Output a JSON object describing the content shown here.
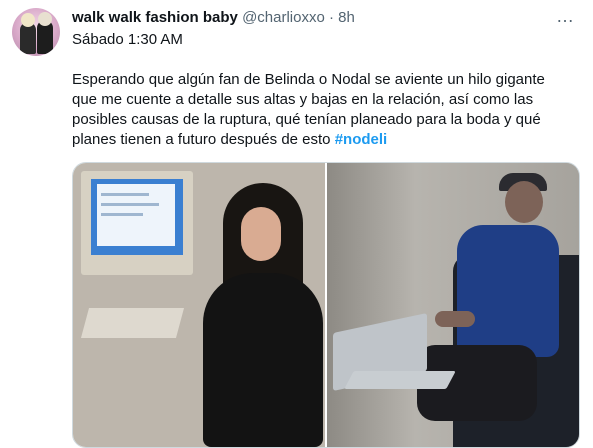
{
  "tweet": {
    "display_name": "walk walk fashion baby",
    "handle": "@charlioxxo",
    "separator": "·",
    "relative_time": "8h",
    "timestamp_text": "Sábado 1:30 AM",
    "body_text": "Esperando que algún fan de Belinda o Nodal se aviente un hilo gigante que me cuente a detalle sus altas y bajas en la relación, así como las posibles causas de la ruptura, qué tenían planeado para la boda y qué planes tienen a futuro después de esto ",
    "hashtag": "#nodeli",
    "more_icon": "…"
  },
  "colors": {
    "hashtag": "#1d9bf0",
    "secondary_text": "#536471",
    "primary_text": "#0f1419",
    "border": "#cfd9de"
  },
  "icons": {
    "avatar": "avatar-icon",
    "more": "more-options-icon"
  }
}
